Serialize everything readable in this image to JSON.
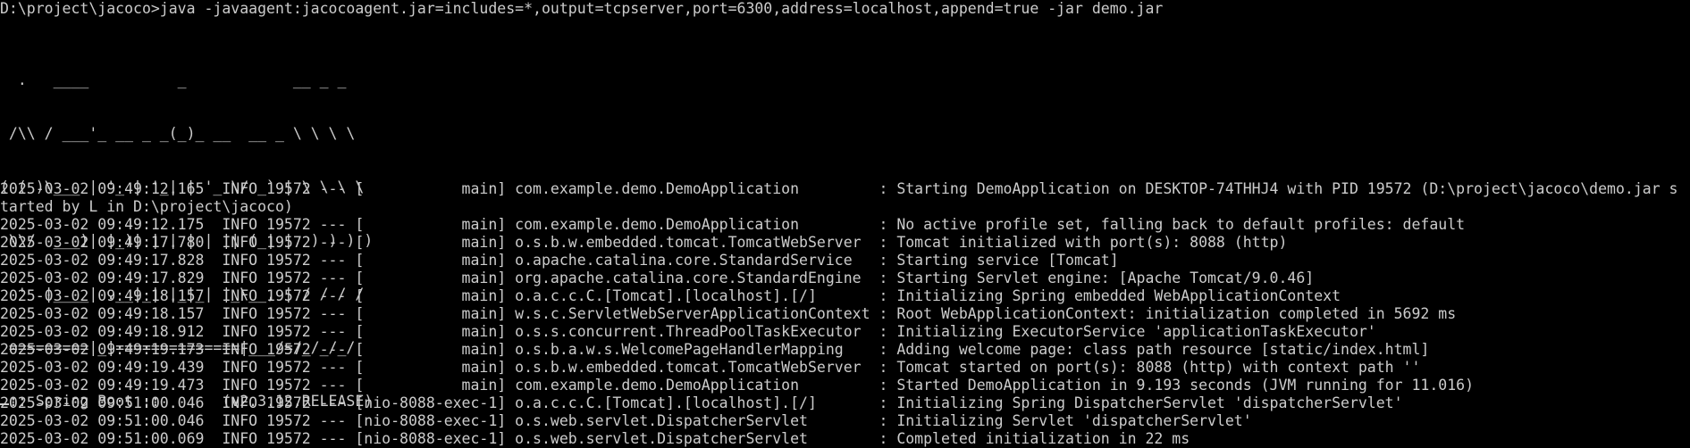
{
  "terminal": {
    "command_line": "D:\\project\\jacoco>java -javaagent:jacocoagent.jar=includes=*,output=tcpserver,port=6300,address=localhost,append=true -jar demo.jar",
    "banner": [
      "  .   ____          _            __ _ _",
      " /\\\\ / ___'_ __ _ _(_)_ __  __ _ \\ \\ \\ \\",
      "( ( )\\___ | '_ | '_| | '_ \\/ _` | \\ \\ \\ \\",
      " \\\\/  ___)| |_)| | | | | || (_| |  ) ) ) )",
      "  '  |____| .__|_| |_|_| |_\\__, | / / / /",
      " =========|_|==============|___/=/_/_/_/",
      " :: Spring Boot ::       (v2.3.12.RELEASE)"
    ],
    "log_lines": [
      "2025-03-02 09:49:12.165  INFO 19572 --- [           main] com.example.demo.DemoApplication         : Starting DemoApplication on DESKTOP-74THHJ4 with PID 19572 (D:\\project\\jacoco\\demo.jar s",
      "tarted by L in D:\\project\\jacoco)",
      "2025-03-02 09:49:12.175  INFO 19572 --- [           main] com.example.demo.DemoApplication         : No active profile set, falling back to default profiles: default",
      "2025-03-02 09:49:17.780  INFO 19572 --- [           main] o.s.b.w.embedded.tomcat.TomcatWebServer  : Tomcat initialized with port(s): 8088 (http)",
      "2025-03-02 09:49:17.828  INFO 19572 --- [           main] o.apache.catalina.core.StandardService   : Starting service [Tomcat]",
      "2025-03-02 09:49:17.829  INFO 19572 --- [           main] org.apache.catalina.core.StandardEngine  : Starting Servlet engine: [Apache Tomcat/9.0.46]",
      "2025-03-02 09:49:18.157  INFO 19572 --- [           main] o.a.c.c.C.[Tomcat].[localhost].[/]       : Initializing Spring embedded WebApplicationContext",
      "2025-03-02 09:49:18.157  INFO 19572 --- [           main] w.s.c.ServletWebServerApplicationContext : Root WebApplicationContext: initialization completed in 5692 ms",
      "2025-03-02 09:49:18.912  INFO 19572 --- [           main] o.s.s.concurrent.ThreadPoolTaskExecutor  : Initializing ExecutorService 'applicationTaskExecutor'",
      "2025-03-02 09:49:19.173  INFO 19572 --- [           main] o.s.b.a.w.s.WelcomePageHandlerMapping    : Adding welcome page: class path resource [static/index.html]",
      "2025-03-02 09:49:19.439  INFO 19572 --- [           main] o.s.b.w.embedded.tomcat.TomcatWebServer  : Tomcat started on port(s): 8088 (http) with context path ''",
      "2025-03-02 09:49:19.473  INFO 19572 --- [           main] com.example.demo.DemoApplication         : Started DemoApplication in 9.193 seconds (JVM running for 11.016)",
      "2025-03-02 09:51:00.046  INFO 19572 --- [nio-8088-exec-1] o.a.c.c.C.[Tomcat].[localhost].[/]       : Initializing Spring DispatcherServlet 'dispatcherServlet'",
      "2025-03-02 09:51:00.046  INFO 19572 --- [nio-8088-exec-1] o.s.web.servlet.DispatcherServlet        : Initializing Servlet 'dispatcherServlet'",
      "2025-03-02 09:51:00.069  INFO 19572 --- [nio-8088-exec-1] o.s.web.servlet.DispatcherServlet        : Completed initialization in 22 ms"
    ]
  },
  "colors": {
    "background": "#000000",
    "text": "#cccccc"
  }
}
